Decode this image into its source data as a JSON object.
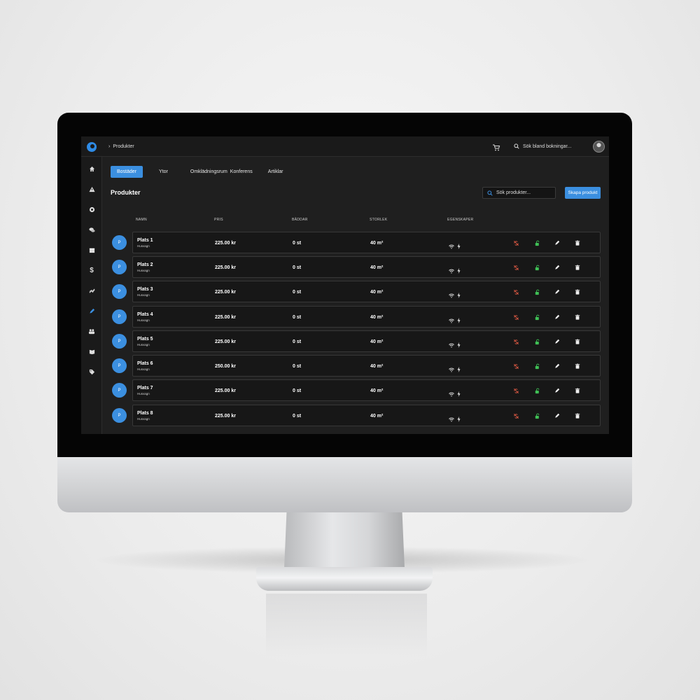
{
  "topbar": {
    "breadcrumb_sep": "›",
    "breadcrumb": "Produkter",
    "search_placeholder": "Sök bland bokningar..."
  },
  "sidebar": {
    "items": [
      "home-icon",
      "warning-icon",
      "soccer-icon",
      "chat-icon",
      "calendar-icon",
      "dollar-icon",
      "trend-icon",
      "pencil-icon",
      "group-icon",
      "book-icon",
      "tag-icon"
    ],
    "dollar_glyph": "$",
    "active": "pencil-icon"
  },
  "tabs": [
    "Bostäder",
    "Ytor",
    "Omklädningsrum",
    "Konferens",
    "Artiklar"
  ],
  "active_tab": "Bostäder",
  "page": {
    "title": "Produkter",
    "search_placeholder": "Sök produkter...",
    "create_label": "Skapa produkt"
  },
  "table": {
    "headers": [
      "NAMN",
      "PRIS",
      "BÄDDAR",
      "STORLEK",
      "EGENSKAPER"
    ],
    "rows": [
      {
        "avatar": "P",
        "name": "Plats 1",
        "type": "Husvagn",
        "price": "225.00 kr",
        "beds": "0 st",
        "size": "40 m²"
      },
      {
        "avatar": "P",
        "name": "Plats 2",
        "type": "Husvagn",
        "price": "225.00 kr",
        "beds": "0 st",
        "size": "40 m²"
      },
      {
        "avatar": "P",
        "name": "Plats 3",
        "type": "Husvagn",
        "price": "225.00 kr",
        "beds": "0 st",
        "size": "40 m²"
      },
      {
        "avatar": "P",
        "name": "Plats 4",
        "type": "Husvagn",
        "price": "225.00 kr",
        "beds": "0 st",
        "size": "40 m²"
      },
      {
        "avatar": "P",
        "name": "Plats 5",
        "type": "Husvagn",
        "price": "225.00 kr",
        "beds": "0 st",
        "size": "40 m²"
      },
      {
        "avatar": "P",
        "name": "Plats 6",
        "type": "Husvagn",
        "price": "250.00 kr",
        "beds": "0 st",
        "size": "40 m²"
      },
      {
        "avatar": "P",
        "name": "Plats 7",
        "type": "Husvagn",
        "price": "225.00 kr",
        "beds": "0 st",
        "size": "40 m²"
      },
      {
        "avatar": "P",
        "name": "Plats 8",
        "type": "Husvagn",
        "price": "225.00 kr",
        "beds": "0 st",
        "size": "40 m²"
      }
    ],
    "features": [
      "wifi-icon",
      "bolt-icon"
    ],
    "actions": [
      "sync-off-icon",
      "unlock-icon",
      "edit-icon",
      "delete-icon"
    ]
  },
  "colors": {
    "accent": "#3b8fe0",
    "background": "#1f1f1f",
    "danger": "#e25b45",
    "success": "#3fbf55"
  }
}
